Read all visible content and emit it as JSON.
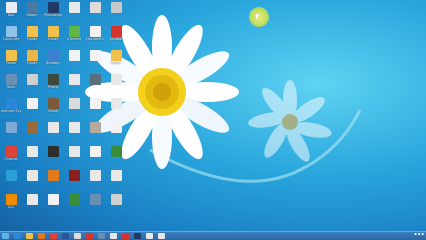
{
  "desktop": {
    "icons": [
      {
        "label": "Doc",
        "color": "#e9eef5"
      },
      {
        "label": "Steam",
        "color": "#4b79a6"
      },
      {
        "label": "Photoshop",
        "color": "#1f3a66"
      },
      {
        "label": "",
        "color": "#e8e8e8"
      },
      {
        "label": "",
        "color": "#dcdcdc"
      },
      {
        "label": "",
        "color": "#c9c9c9"
      },
      {
        "label": "Computer",
        "color": "#8fc3ea"
      },
      {
        "label": "Folder",
        "color": "#f0c24b"
      },
      {
        "label": "Folder",
        "color": "#f0c24b"
      },
      {
        "label": "uTorrent",
        "color": "#5fb646"
      },
      {
        "label": "Document",
        "color": "#f2f2f2"
      },
      {
        "label": "Acrobat",
        "color": "#d4342b"
      },
      {
        "label": "Folder",
        "color": "#f0c24b"
      },
      {
        "label": "Folder",
        "color": "#e8b64a"
      },
      {
        "label": "Browser",
        "color": "#3d7fd2"
      },
      {
        "label": "",
        "color": "#f2f2f2"
      },
      {
        "label": "",
        "color": "#f2f2f2"
      },
      {
        "label": "Folder",
        "color": "#f0c24b"
      },
      {
        "label": "Tools",
        "color": "#6a8fb7"
      },
      {
        "label": "",
        "color": "#cfcfcf"
      },
      {
        "label": "Photo",
        "color": "#3d4a3a"
      },
      {
        "label": "",
        "color": "#e8e8e8"
      },
      {
        "label": "",
        "color": "#5a6e7e"
      },
      {
        "label": "",
        "color": "#e8e8e8"
      },
      {
        "label": "Internet Explorer",
        "color": "#2b88d8"
      },
      {
        "label": "",
        "color": "#f2f2f2"
      },
      {
        "label": "Game",
        "color": "#7a5a3a"
      },
      {
        "label": "",
        "color": "#dcdcdc"
      },
      {
        "label": "",
        "color": "#f2f2f2"
      },
      {
        "label": "",
        "color": "#e8e8e8"
      },
      {
        "label": "",
        "color": "#7fa9d4"
      },
      {
        "label": "",
        "color": "#9a6a3a"
      },
      {
        "label": "",
        "color": "#e8e8e8"
      },
      {
        "label": "",
        "color": "#e8e8e8"
      },
      {
        "label": "",
        "color": "#b5a9a0"
      },
      {
        "label": "",
        "color": "#f2f2f2"
      },
      {
        "label": "Chrome",
        "color": "#db4437"
      },
      {
        "label": "",
        "color": "#e8e8e8"
      },
      {
        "label": "",
        "color": "#2e2e2e"
      },
      {
        "label": "",
        "color": "#e8e8e8"
      },
      {
        "label": "",
        "color": "#f2f2f2"
      },
      {
        "label": "",
        "color": "#3a8c3a"
      },
      {
        "label": "",
        "color": "#2a9fd6"
      },
      {
        "label": "",
        "color": "#e8e8e8"
      },
      {
        "label": "",
        "color": "#e07a1a"
      },
      {
        "label": "",
        "color": "#8b1e1e"
      },
      {
        "label": "",
        "color": "#e8e8e8"
      },
      {
        "label": "",
        "color": "#e8e8e8"
      },
      {
        "label": "VLC",
        "color": "#f08a00"
      },
      {
        "label": "",
        "color": "#e8e8e8"
      },
      {
        "label": "",
        "color": "#f2f2f2"
      },
      {
        "label": "",
        "color": "#3a8c3a"
      },
      {
        "label": "",
        "color": "#6a8fb7"
      },
      {
        "label": "",
        "color": "#d0d0d0"
      }
    ]
  },
  "taskbar": {
    "items": [
      {
        "name": "start",
        "color": "#5fb2e8"
      },
      {
        "name": "ie",
        "color": "#2b88d8"
      },
      {
        "name": "explorer",
        "color": "#f0c24b"
      },
      {
        "name": "media",
        "color": "#e07a1a"
      },
      {
        "name": "chrome",
        "color": "#db4437"
      },
      {
        "name": "word",
        "color": "#2b579a"
      },
      {
        "name": "app1",
        "color": "#dcdcdc"
      },
      {
        "name": "app2",
        "color": "#d4342b"
      },
      {
        "name": "app3",
        "color": "#6a8fb7"
      },
      {
        "name": "app4",
        "color": "#e8e8e8"
      },
      {
        "name": "app5",
        "color": "#d4342b"
      },
      {
        "name": "photoshop",
        "color": "#1f3a66"
      },
      {
        "name": "app6",
        "color": "#e8e8e8"
      },
      {
        "name": "app7",
        "color": "#e8e8e8"
      }
    ]
  }
}
